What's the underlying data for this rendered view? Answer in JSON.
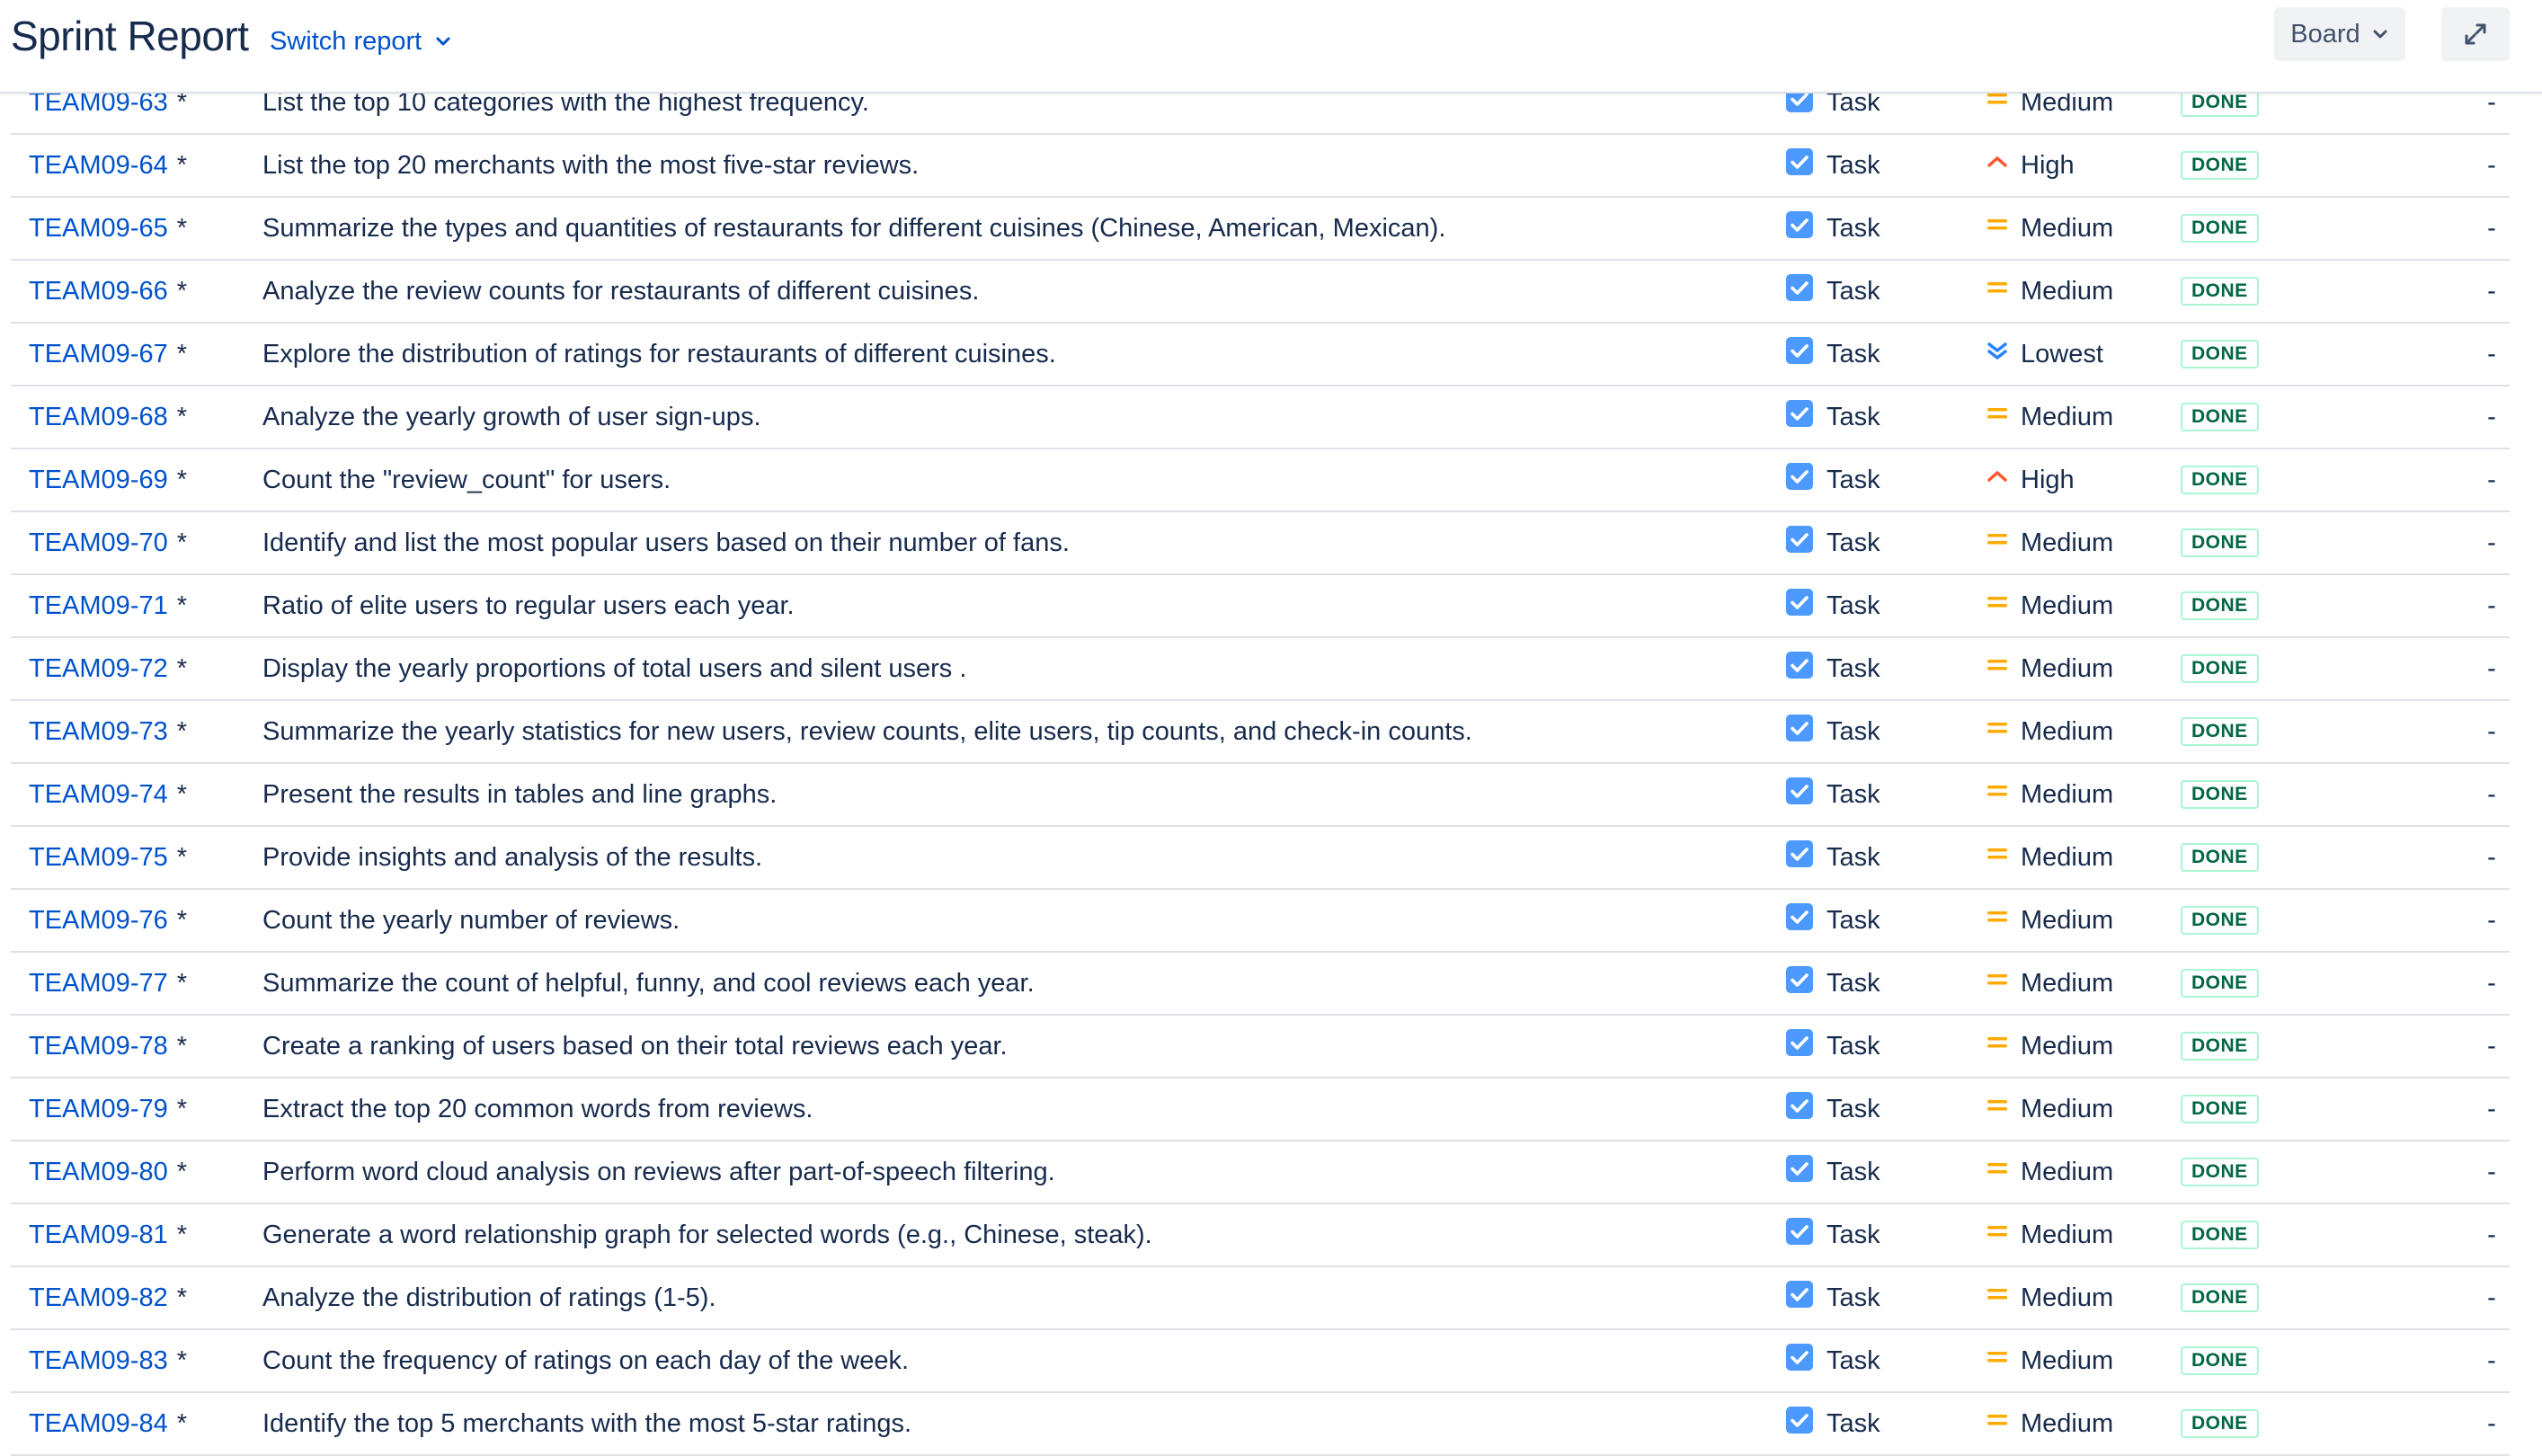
{
  "header": {
    "title": "Sprint Report",
    "switch_label": "Switch report",
    "board_label": "Board"
  },
  "colors": {
    "link": "#0052CC",
    "text": "#172B4D",
    "done_text": "#006644",
    "done_border": "#ABF5D1",
    "task_icon": "#4C9AFF",
    "priority_medium": "#FFAB00",
    "priority_high": "#FF5630",
    "priority_lowest": "#2684FF"
  },
  "rows": [
    {
      "key": "TEAM09-63",
      "flag": "*",
      "summary": "List the top 10 categories with the highest frequency.",
      "type": "Task",
      "priority": "Medium",
      "status": "DONE",
      "points": "-"
    },
    {
      "key": "TEAM09-64",
      "flag": "*",
      "summary": "List the top 20 merchants with the most five-star reviews.",
      "type": "Task",
      "priority": "High",
      "status": "DONE",
      "points": "-"
    },
    {
      "key": "TEAM09-65",
      "flag": "*",
      "summary": "Summarize the types and quantities of restaurants for different cuisines (Chinese, American, Mexican).",
      "type": "Task",
      "priority": "Medium",
      "status": "DONE",
      "points": "-"
    },
    {
      "key": "TEAM09-66",
      "flag": "*",
      "summary": "Analyze the review counts for restaurants of different cuisines.",
      "type": "Task",
      "priority": "Medium",
      "status": "DONE",
      "points": "-"
    },
    {
      "key": "TEAM09-67",
      "flag": "*",
      "summary": "Explore the distribution of ratings for restaurants of different cuisines.",
      "type": "Task",
      "priority": "Lowest",
      "status": "DONE",
      "points": "-"
    },
    {
      "key": "TEAM09-68",
      "flag": "*",
      "summary": "Analyze the yearly growth of user sign-ups.",
      "type": "Task",
      "priority": "Medium",
      "status": "DONE",
      "points": "-"
    },
    {
      "key": "TEAM09-69",
      "flag": "*",
      "summary": "Count the \"review_count\" for users.",
      "type": "Task",
      "priority": "High",
      "status": "DONE",
      "points": "-"
    },
    {
      "key": "TEAM09-70",
      "flag": "*",
      "summary": "Identify and list the most popular users based on their number of fans.",
      "type": "Task",
      "priority": "Medium",
      "status": "DONE",
      "points": "-"
    },
    {
      "key": "TEAM09-71",
      "flag": "*",
      "summary": "Ratio of elite users to regular users each year.",
      "type": "Task",
      "priority": "Medium",
      "status": "DONE",
      "points": "-"
    },
    {
      "key": "TEAM09-72",
      "flag": "*",
      "summary": "Display the yearly proportions of total users and silent users .",
      "type": "Task",
      "priority": "Medium",
      "status": "DONE",
      "points": "-"
    },
    {
      "key": "TEAM09-73",
      "flag": "*",
      "summary": "Summarize the yearly statistics for new users, review counts, elite users, tip counts, and check-in counts.",
      "type": "Task",
      "priority": "Medium",
      "status": "DONE",
      "points": "-"
    },
    {
      "key": "TEAM09-74",
      "flag": "*",
      "summary": "Present the results in tables and line graphs.",
      "type": "Task",
      "priority": "Medium",
      "status": "DONE",
      "points": "-"
    },
    {
      "key": "TEAM09-75",
      "flag": "*",
      "summary": "Provide insights and analysis of the results.",
      "type": "Task",
      "priority": "Medium",
      "status": "DONE",
      "points": "-"
    },
    {
      "key": "TEAM09-76",
      "flag": "*",
      "summary": "Count the yearly number of reviews.",
      "type": "Task",
      "priority": "Medium",
      "status": "DONE",
      "points": "-"
    },
    {
      "key": "TEAM09-77",
      "flag": "*",
      "summary": "Summarize the count of helpful, funny, and cool reviews each year.",
      "type": "Task",
      "priority": "Medium",
      "status": "DONE",
      "points": "-"
    },
    {
      "key": "TEAM09-78",
      "flag": "*",
      "summary": "Create a ranking of users based on their total reviews each year.",
      "type": "Task",
      "priority": "Medium",
      "status": "DONE",
      "points": "-"
    },
    {
      "key": "TEAM09-79",
      "flag": "*",
      "summary": "Extract the top 20 common words from reviews.",
      "type": "Task",
      "priority": "Medium",
      "status": "DONE",
      "points": "-"
    },
    {
      "key": "TEAM09-80",
      "flag": "*",
      "summary": "Perform word cloud analysis on reviews after part-of-speech filtering.",
      "type": "Task",
      "priority": "Medium",
      "status": "DONE",
      "points": "-"
    },
    {
      "key": "TEAM09-81",
      "flag": "*",
      "summary": "Generate a word relationship graph for selected words (e.g., Chinese, steak).",
      "type": "Task",
      "priority": "Medium",
      "status": "DONE",
      "points": "-"
    },
    {
      "key": "TEAM09-82",
      "flag": "*",
      "summary": "Analyze the distribution of ratings (1-5).",
      "type": "Task",
      "priority": "Medium",
      "status": "DONE",
      "points": "-"
    },
    {
      "key": "TEAM09-83",
      "flag": "*",
      "summary": "Count the frequency of ratings on each day of the week.",
      "type": "Task",
      "priority": "Medium",
      "status": "DONE",
      "points": "-"
    },
    {
      "key": "TEAM09-84",
      "flag": "*",
      "summary": "Identify the top 5 merchants with the most 5-star ratings.",
      "type": "Task",
      "priority": "Medium",
      "status": "DONE",
      "points": "-"
    }
  ]
}
